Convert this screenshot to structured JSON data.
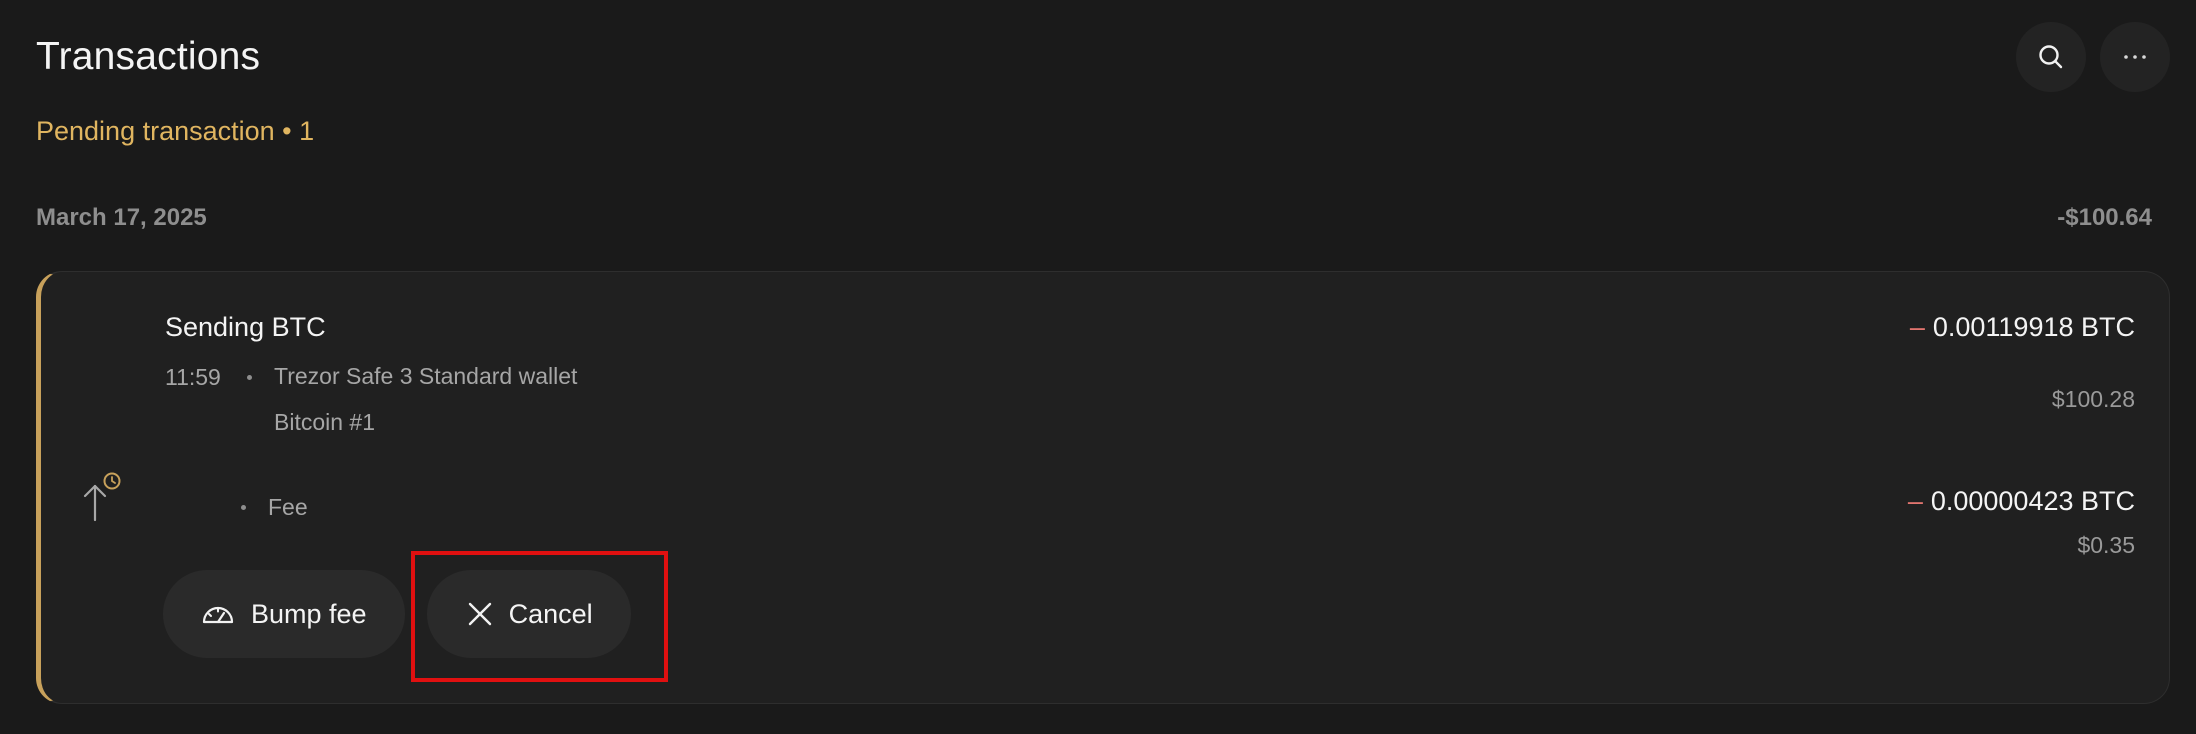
{
  "header": {
    "title": "Transactions",
    "search_icon": "search-icon",
    "more_icon": "ellipsis-icon"
  },
  "pending": {
    "label": "Pending transaction • 1"
  },
  "group": {
    "date": "March 17, 2025",
    "total": "-$100.64"
  },
  "transaction": {
    "title": "Sending BTC",
    "time": "11:59",
    "wallet": "Trezor Safe 3 Standard wallet",
    "account": "Bitcoin #1",
    "minus_sign": "–",
    "amount": "0.00119918 BTC",
    "amount_fiat": "$100.28",
    "fee_label": "Fee",
    "fee_amount": "0.00000423 BTC",
    "fee_fiat": "$0.35",
    "icon": "send-pending-icon"
  },
  "actions": {
    "bump_fee": "Bump fee",
    "cancel": "Cancel"
  },
  "colors": {
    "accent": "#e0b560",
    "card_border_left": "#c8a15b",
    "negative": "#e2756f",
    "highlight": "#e01010"
  }
}
